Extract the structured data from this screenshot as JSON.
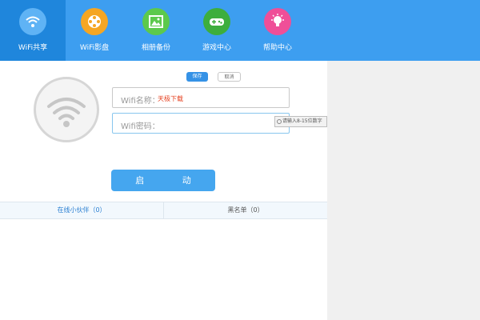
{
  "nav": {
    "tabs": [
      {
        "label": "WiFi共享",
        "icon": "wifi-icon",
        "color": "#1f86dc",
        "active": true
      },
      {
        "label": "WiFi影盘",
        "icon": "film-reel-icon",
        "color": "#f5a623"
      },
      {
        "label": "相册备份",
        "icon": "photo-icon",
        "color": "#5cc94c"
      },
      {
        "label": "游戏中心",
        "icon": "gamepad-icon",
        "color": "#3dae3d"
      },
      {
        "label": "帮助中心",
        "icon": "lightbulb-icon",
        "color": "#ef4f98"
      }
    ]
  },
  "actions": {
    "save_label": "保存",
    "cancel_label": "取消"
  },
  "form": {
    "name_label": "Wifi名称：",
    "name_value": "天极下载",
    "password_label": "Wifi密码：",
    "password_hint": "请输入8-15位数字"
  },
  "start_label": "启 动",
  "lists": {
    "online_label": "在线小伙伴（0）",
    "blacklist_label": "黑名单（0）"
  },
  "colors": {
    "topbar": "#3d9ef0",
    "accent": "#3592e6"
  }
}
